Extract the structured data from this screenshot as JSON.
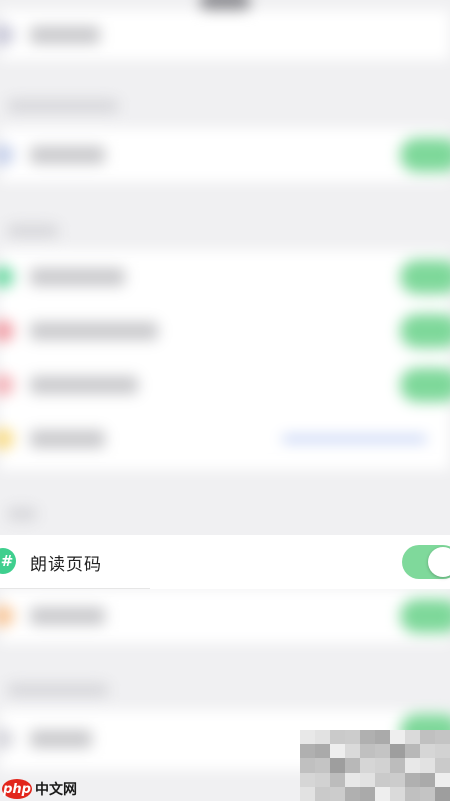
{
  "focused_row": {
    "icon": "hash-icon",
    "icon_glyph": "#",
    "title": "朗读页码",
    "toggle_on": true,
    "toggle_color": "#7fd99b",
    "icon_color": "#3fcf8e"
  },
  "watermark": {
    "logo_text": "php",
    "site_text": "中文网"
  },
  "colors": {
    "background": "#f0f0f2",
    "toggle_on": "#7ed89a",
    "accent_blue": "#b3c5f2"
  }
}
